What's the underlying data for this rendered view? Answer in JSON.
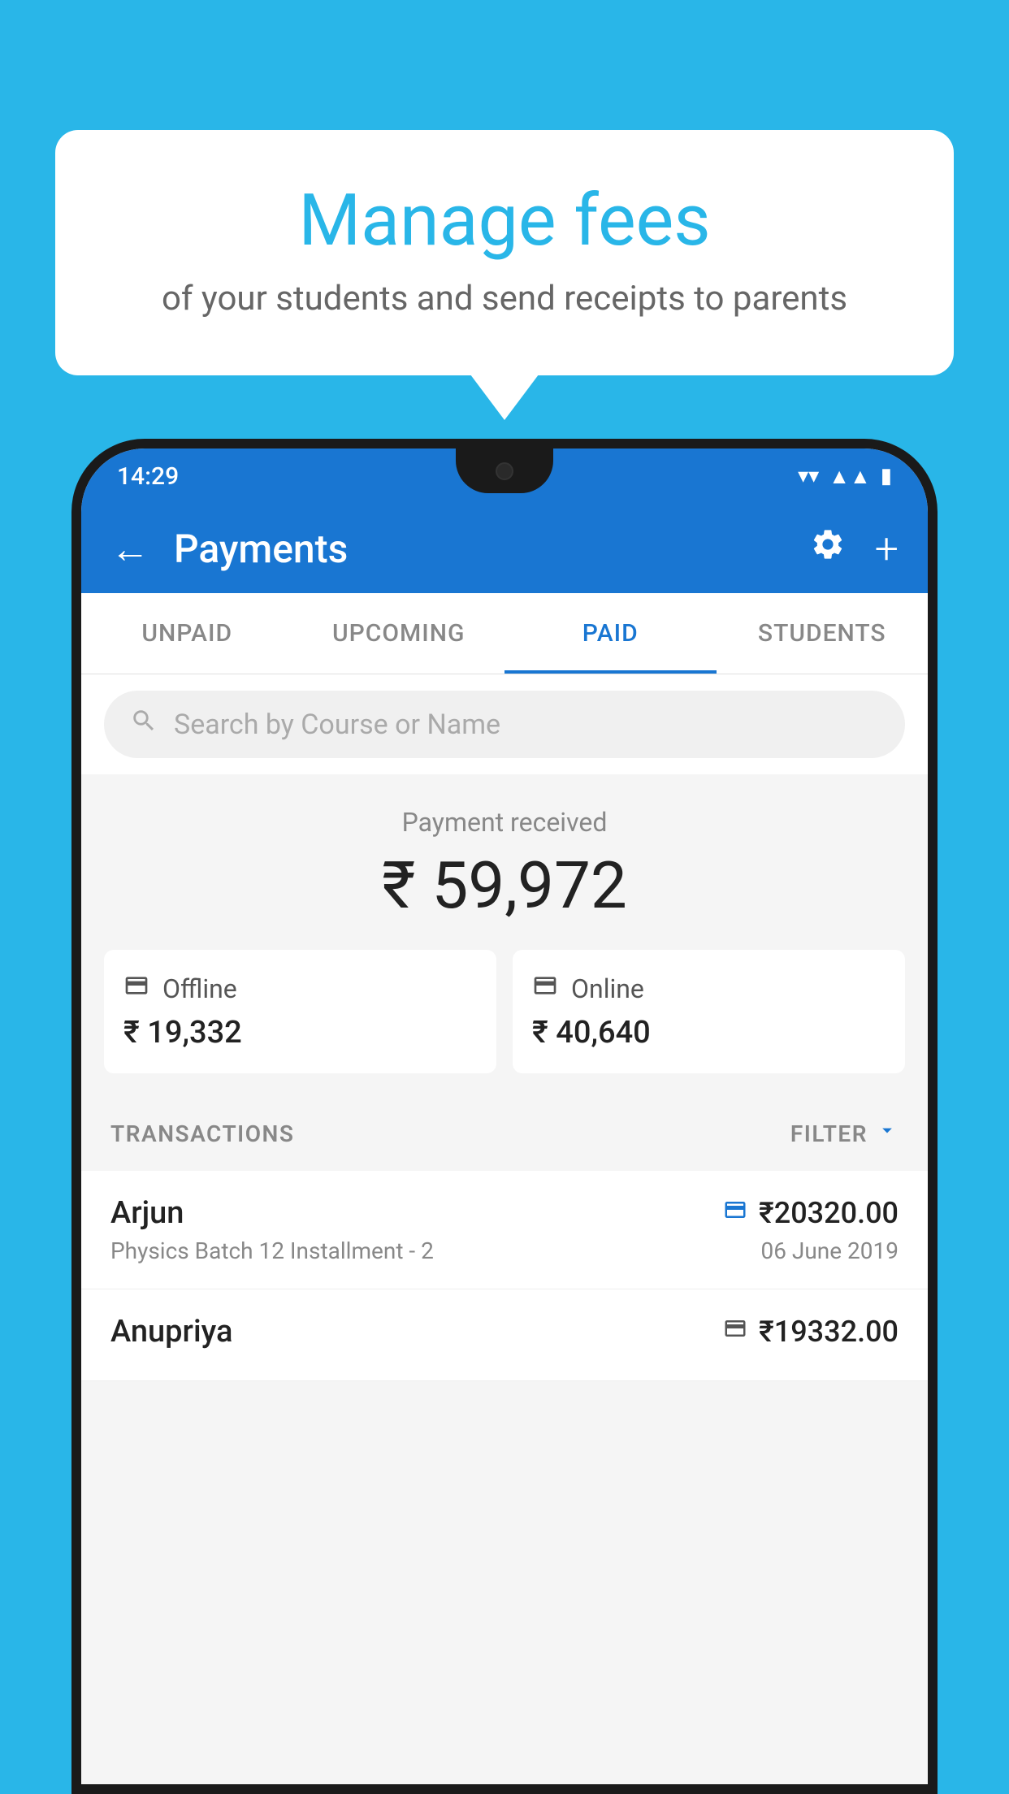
{
  "background_color": "#29b6e8",
  "bubble": {
    "title": "Manage fees",
    "subtitle": "of your students and send receipts to parents"
  },
  "status_bar": {
    "time": "14:29",
    "wifi_icon": "▼",
    "signal_icon": "▲",
    "battery_icon": "▮"
  },
  "app_bar": {
    "title": "Payments",
    "back_icon": "←",
    "settings_icon": "⚙",
    "add_icon": "+"
  },
  "tabs": [
    {
      "label": "UNPAID",
      "active": false
    },
    {
      "label": "UPCOMING",
      "active": false
    },
    {
      "label": "PAID",
      "active": true
    },
    {
      "label": "STUDENTS",
      "active": false
    }
  ],
  "search": {
    "placeholder": "Search by Course or Name"
  },
  "payment_summary": {
    "label": "Payment received",
    "amount": "₹ 59,972",
    "offline": {
      "label": "Offline",
      "amount": "₹ 19,332",
      "icon": "💳"
    },
    "online": {
      "label": "Online",
      "amount": "₹ 40,640",
      "icon": "💳"
    }
  },
  "transactions_section": {
    "label": "TRANSACTIONS",
    "filter_label": "FILTER",
    "filter_icon": "▼"
  },
  "transactions": [
    {
      "name": "Arjun",
      "course": "Physics Batch 12 Installment - 2",
      "amount": "₹20320.00",
      "date": "06 June 2019",
      "type_icon": "💳"
    },
    {
      "name": "Anupriya",
      "course": "",
      "amount": "₹19332.00",
      "date": "",
      "type_icon": "🏦"
    }
  ]
}
